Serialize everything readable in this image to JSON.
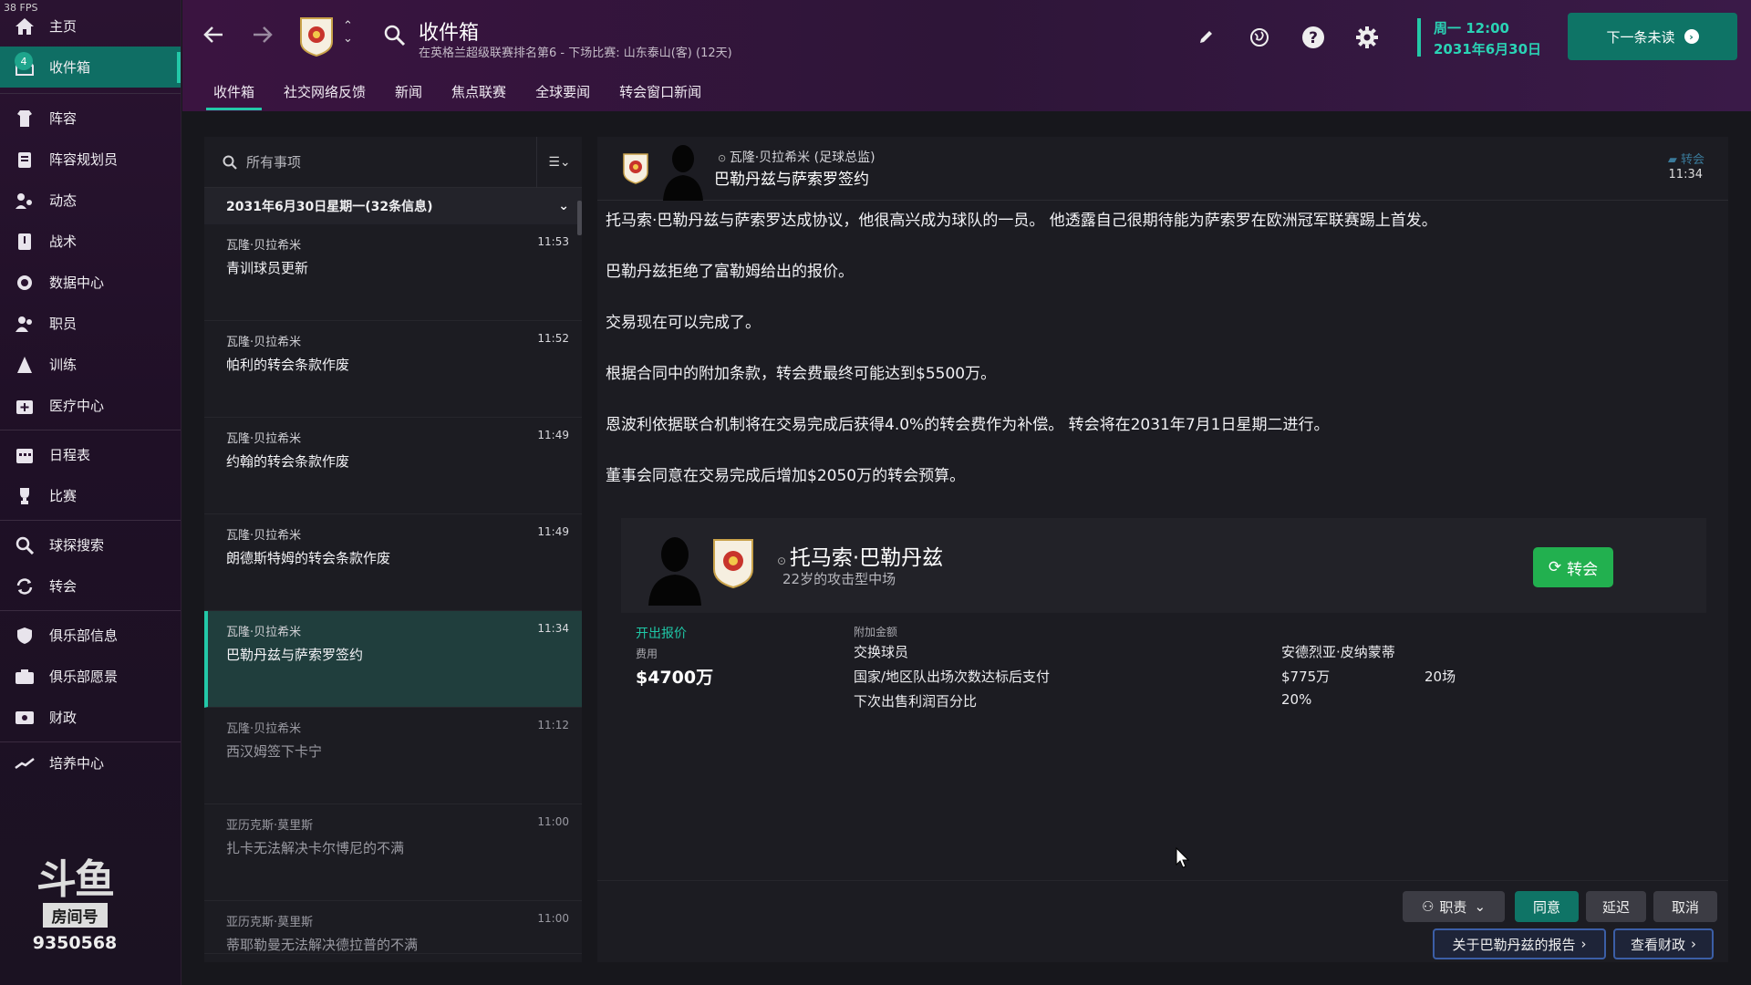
{
  "fps": "38 FPS",
  "sidebar": {
    "items": [
      {
        "label": "主页",
        "icon": "home-icon"
      },
      {
        "label": "收件箱",
        "icon": "inbox-icon",
        "badge": "4",
        "active": true
      },
      {
        "label": "阵容",
        "icon": "squad-icon"
      },
      {
        "label": "阵容规划员",
        "icon": "clipboard-icon"
      },
      {
        "label": "动态",
        "icon": "dynamics-icon"
      },
      {
        "label": "战术",
        "icon": "tactics-icon"
      },
      {
        "label": "数据中心",
        "icon": "data-hub-icon"
      },
      {
        "label": "职员",
        "icon": "staff-icon"
      },
      {
        "label": "训练",
        "icon": "training-icon"
      },
      {
        "label": "医疗中心",
        "icon": "medical-icon"
      },
      {
        "label": "日程表",
        "icon": "calendar-icon"
      },
      {
        "label": "比赛",
        "icon": "trophy-icon"
      },
      {
        "label": "球探搜索",
        "icon": "search-icon"
      },
      {
        "label": "转会",
        "icon": "transfer-icon"
      },
      {
        "label": "俱乐部信息",
        "icon": "shield-icon"
      },
      {
        "label": "俱乐部愿景",
        "icon": "vision-icon"
      },
      {
        "label": "财政",
        "icon": "finance-icon"
      },
      {
        "label": "培养中心",
        "icon": "development-icon"
      }
    ],
    "watermark": {
      "main": "斗鱼",
      "sub": "房间号",
      "room": "9350568"
    }
  },
  "header": {
    "title": "收件箱",
    "subtitle": "在英格兰超级联赛排名第6 - 下场比赛: 山东泰山(客) (12天)",
    "tabs": [
      "收件箱",
      "社交网络反馈",
      "新闻",
      "焦点联赛",
      "全球要闻",
      "转会窗口新闻"
    ],
    "active_tab": 0,
    "date_line1": "周一 12:00",
    "date_line2": "2031年6月30日",
    "next_button": "下一条未读",
    "accent_color": "#23c8a8"
  },
  "inbox": {
    "search_placeholder": "所有事项",
    "day_header": "2031年6月30日星期一(32条信息)",
    "messages": [
      {
        "from": "瓦隆·贝拉希米",
        "subject": "青训球员更新",
        "time": "11:53"
      },
      {
        "from": "瓦隆·贝拉希米",
        "subject": "帕利的转会条款作废",
        "time": "11:52"
      },
      {
        "from": "瓦隆·贝拉希米",
        "subject": "约翰的转会条款作废",
        "time": "11:49"
      },
      {
        "from": "瓦隆·贝拉希米",
        "subject": "朗德斯特姆的转会条款作废",
        "time": "11:49"
      },
      {
        "from": "瓦隆·贝拉希米",
        "subject": "巴勒丹兹与萨索罗签约",
        "time": "11:34",
        "selected": true
      },
      {
        "from": "瓦隆·贝拉希米",
        "subject": "西汉姆签下卡宁",
        "time": "11:12",
        "dim": true
      },
      {
        "from": "亚历克斯·莫里斯",
        "subject": "扎卡无法解决卡尔博尼的不满",
        "time": "11:00",
        "dim": true
      },
      {
        "from": "亚历克斯·莫里斯",
        "subject": "蒂耶勒曼无法解决德拉普的不满",
        "time": "11:00",
        "dim": true
      }
    ]
  },
  "detail": {
    "sender": "瓦隆·贝拉希米 (足球总监)",
    "title": "巴勒丹兹与萨索罗签约",
    "tag": "转会",
    "time": "11:34",
    "paragraphs": [
      "托马索·巴勒丹兹与萨索罗达成协议，他很高兴成为球队的一员。 他透露自己很期待能为萨索罗在欧洲冠军联赛踢上首发。",
      "巴勒丹兹拒绝了富勒姆给出的报价。",
      "交易现在可以完成了。",
      "根据合同中的附加条款，转会费最终可能达到$5500万。",
      "恩波利依据联合机制将在交易完成后获得4.0%的转会费作为补偿。 转会将在2031年7月1日星期二进行。",
      "董事会同意在交易完成后增加$2050万的转会预算。"
    ],
    "player": {
      "name": "托马索·巴勒丹兹",
      "desc": "22岁的攻击型中场",
      "transfer_button": "转会"
    },
    "offer": {
      "heading": "开出报价",
      "fee_label": "费用",
      "fee_value": "$4700万",
      "extras_label": "附加金额",
      "rows": [
        {
          "label": "交换球员",
          "value": "安德烈亚·皮纳蒙蒂",
          "extra": ""
        },
        {
          "label": "国家/地区队出场次数达标后支付",
          "value": "$775万",
          "extra": "20场"
        },
        {
          "label": "下次出售利润百分比",
          "value": "20%",
          "extra": ""
        }
      ]
    },
    "actions": {
      "duty": "职责",
      "agree": "同意",
      "delay": "延迟",
      "cancel": "取消",
      "report": "关于巴勒丹兹的报告",
      "finance": "查看财政"
    }
  }
}
